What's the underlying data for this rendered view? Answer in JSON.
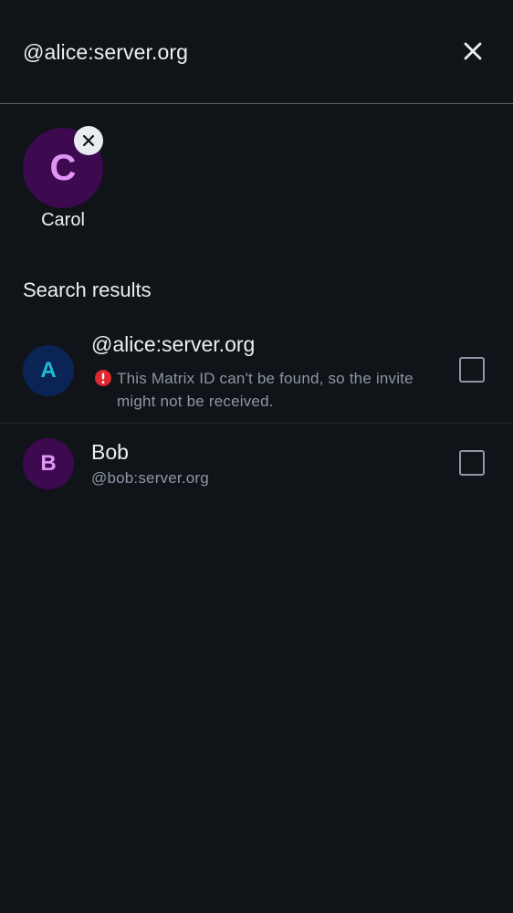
{
  "search": {
    "value": "@alice:server.org"
  },
  "selected_users": [
    {
      "initial": "C",
      "name": "Carol",
      "avatar_bg": "#3D0A4F",
      "avatar_fg": "#E294F5"
    }
  ],
  "results_section": {
    "title": "Search results"
  },
  "results": [
    {
      "initial": "A",
      "title": "@alice:server.org",
      "warning": "This Matrix ID can't be found, so the invite might not be received.",
      "avatar_bg": "#0A2456",
      "avatar_fg": "#21BAD9",
      "checked": false
    },
    {
      "initial": "B",
      "title": "Bob",
      "subtitle": "@bob:server.org",
      "avatar_bg": "#3D0A4F",
      "avatar_fg": "#E294F5",
      "checked": false
    }
  ],
  "icons": {
    "clear": "close-icon",
    "remove_chip": "close-icon",
    "warning": "error-icon"
  },
  "colors": {
    "background": "#101318",
    "text_primary": "#EBEEF2",
    "text_secondary": "#8D97A5",
    "error": "#E0272F"
  }
}
